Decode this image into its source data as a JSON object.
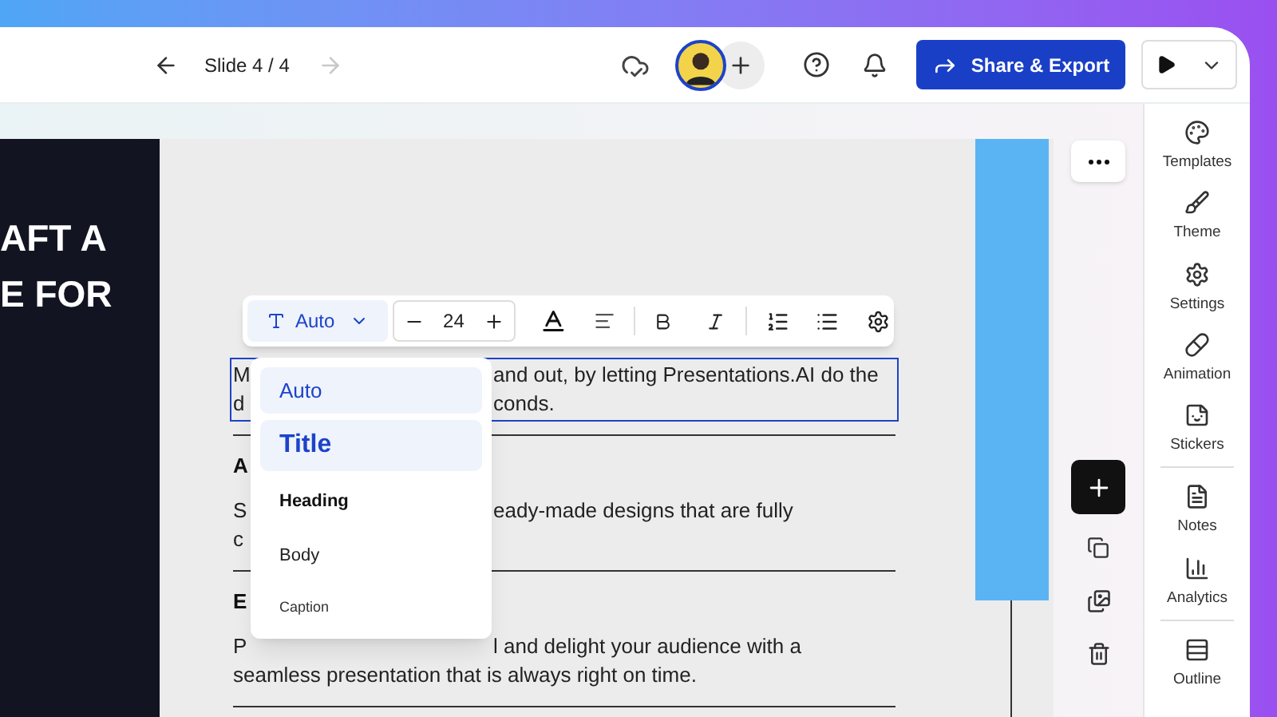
{
  "header": {
    "slide_indicator": "Slide 4 / 4",
    "next_disabled": true,
    "share_button": "Share & Export"
  },
  "slide": {
    "side_panel_lines": [
      "AFT A",
      "E FOR"
    ],
    "sections": [
      {
        "selected": true,
        "lines": [
          {
            "left": "M",
            "right": "and out, by letting Presentations.AI do the"
          },
          {
            "left": "d",
            "right": "conds."
          }
        ]
      },
      {
        "heading": "A",
        "selected": false,
        "lines": [
          {
            "left": "S",
            "right": "eady-made designs that are fully"
          },
          {
            "left": "c"
          }
        ]
      },
      {
        "heading": "E",
        "selected": false,
        "lines": [
          {
            "left": "P",
            "right": "l and delight your audience with a"
          },
          {
            "text": "seamless presentation that is always right on time."
          }
        ]
      }
    ]
  },
  "toolbar": {
    "style": "Auto",
    "font_size": "24"
  },
  "style_menu": [
    {
      "label": "Auto",
      "kind": "auto",
      "selected": true
    },
    {
      "label": "Title",
      "kind": "title",
      "selected": true
    },
    {
      "label": "Heading",
      "kind": "heading",
      "selected": false
    },
    {
      "label": "Body",
      "kind": "body",
      "selected": false
    },
    {
      "label": "Caption",
      "kind": "caption",
      "selected": false
    }
  ],
  "sidebar": {
    "groups": [
      [
        {
          "label": "Templates"
        },
        {
          "label": "Theme"
        },
        {
          "label": "Settings"
        },
        {
          "label": "Animation"
        },
        {
          "label": "Stickers"
        }
      ],
      [
        {
          "label": "Notes"
        },
        {
          "label": "Analytics"
        }
      ],
      [
        {
          "label": "Outline"
        }
      ]
    ]
  }
}
